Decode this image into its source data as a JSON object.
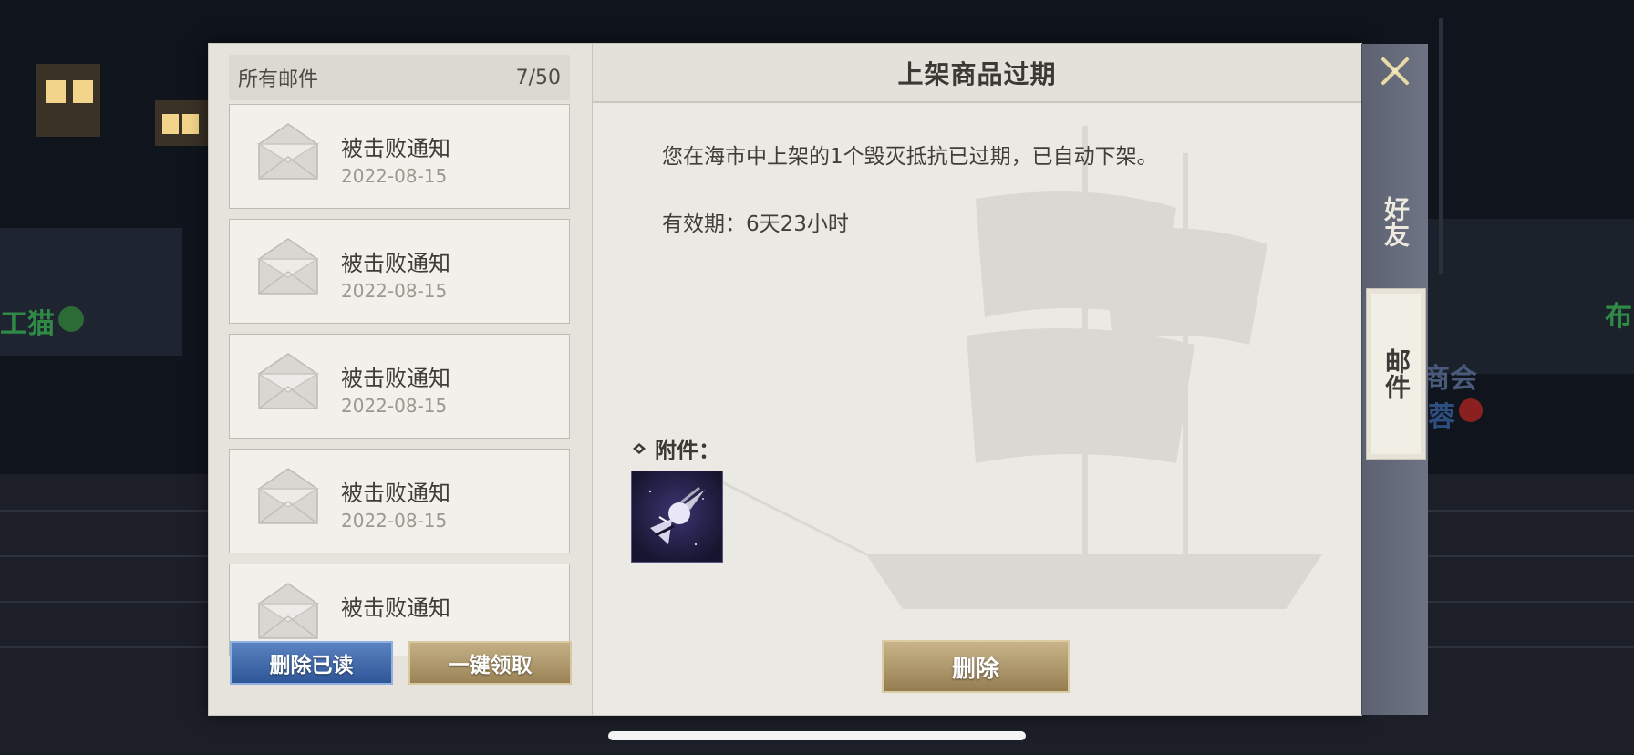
{
  "background": {
    "left_label": "工猫",
    "right_label_top": "布",
    "right_label_mid": "商会",
    "right_label_low": "蓉"
  },
  "mail_list": {
    "header_label": "所有邮件",
    "count": "7/50",
    "items": [
      {
        "title": "被击败通知",
        "date": "2022-08-15"
      },
      {
        "title": "被击败通知",
        "date": "2022-08-15"
      },
      {
        "title": "被击败通知",
        "date": "2022-08-15"
      },
      {
        "title": "被击败通知",
        "date": "2022-08-15"
      },
      {
        "title": "被击败通知",
        "date": ""
      }
    ]
  },
  "actions": {
    "delete_read": "删除已读",
    "claim_all": "一键领取",
    "delete": "删除"
  },
  "detail": {
    "title": "上架商品过期",
    "message": "您在海市中上架的1个毁灭抵抗已过期，已自动下架。",
    "validity": "有效期：6天23小时",
    "attachment_label": "附件：",
    "attachment_icon": "comet-skill-icon"
  },
  "tabs": {
    "friends": "好友",
    "mail": "邮件"
  },
  "colors": {
    "blue_button": "#2f5798",
    "gold_button": "#9a8356",
    "side_panel": "#5b6170"
  }
}
